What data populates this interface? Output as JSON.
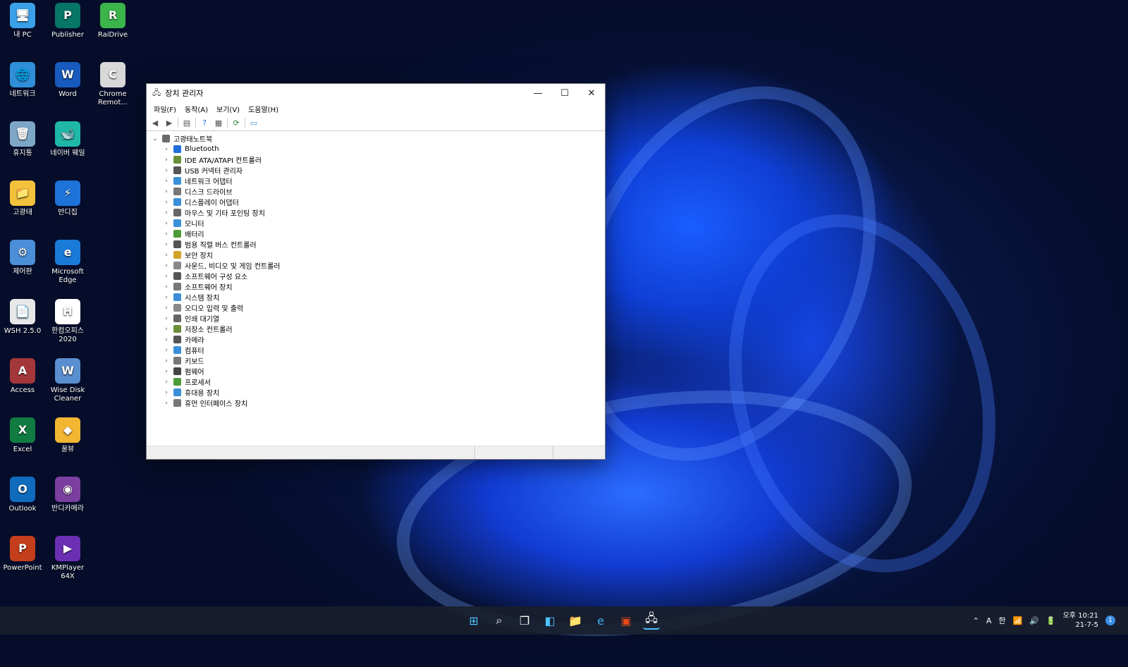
{
  "desktop_icons": [
    {
      "label": "내 PC",
      "color": "#3aa0e8",
      "glyph": "🖥"
    },
    {
      "label": "Publisher",
      "color": "#077568",
      "glyph": "P"
    },
    {
      "label": "RaiDrive",
      "color": "#3bb54a",
      "glyph": "R"
    },
    {
      "label": "네트워크",
      "color": "#2f8fd8",
      "glyph": "🌐"
    },
    {
      "label": "Word",
      "color": "#185abd",
      "glyph": "W"
    },
    {
      "label": "Chrome Remot...",
      "color": "#d8d8d8",
      "glyph": "C"
    },
    {
      "label": "휴지통",
      "color": "#7ea7c7",
      "glyph": "🗑"
    },
    {
      "label": "네이버 웨일",
      "color": "#1fb8a8",
      "glyph": "🐋"
    },
    {
      "label": "고광태",
      "color": "#f3c23c",
      "glyph": "📁"
    },
    {
      "label": "반디집",
      "color": "#1e73d8",
      "glyph": "⚡"
    },
    {
      "label": "제어판",
      "color": "#4a8fd8",
      "glyph": "⚙"
    },
    {
      "label": "Microsoft Edge",
      "color": "#1a7ad8",
      "glyph": "e"
    },
    {
      "label": "WSH 2.5.0",
      "color": "#e8e8e8",
      "glyph": "📄"
    },
    {
      "label": "한컴오피스 2020",
      "color": "#ffffff",
      "glyph": "H"
    },
    {
      "label": "Access",
      "color": "#a4373a",
      "glyph": "A"
    },
    {
      "label": "Wise Disk Cleaner",
      "color": "#5a8fcf",
      "glyph": "W"
    },
    {
      "label": "Excel",
      "color": "#107c41",
      "glyph": "X"
    },
    {
      "label": "꿀뷰",
      "color": "#f2b632",
      "glyph": "◆"
    },
    {
      "label": "Outlook",
      "color": "#0f6cbd",
      "glyph": "O"
    },
    {
      "label": "반디카메라",
      "color": "#7b3fa0",
      "glyph": "◉"
    },
    {
      "label": "PowerPoint",
      "color": "#c43e1c",
      "glyph": "P"
    },
    {
      "label": "KMPlayer 64X",
      "color": "#6a2fb3",
      "glyph": "▶"
    }
  ],
  "window": {
    "title": "장치 관리자",
    "menu": [
      "파일(F)",
      "동작(A)",
      "보기(V)",
      "도움말(H)"
    ],
    "root": "고광태노트북",
    "devices": [
      {
        "label": "Bluetooth",
        "color": "#1e6fd9"
      },
      {
        "label": "IDE ATA/ATAPI 컨트롤러",
        "color": "#6b8e3a"
      },
      {
        "label": "USB 커넥터 관리자",
        "color": "#555555"
      },
      {
        "label": "네트워크 어댑터",
        "color": "#3b8fd8"
      },
      {
        "label": "디스크 드라이브",
        "color": "#777777"
      },
      {
        "label": "디스플레이 어댑터",
        "color": "#3b8fd8"
      },
      {
        "label": "마우스 및 기타 포인팅 장치",
        "color": "#666666"
      },
      {
        "label": "모니터",
        "color": "#3b8fd8"
      },
      {
        "label": "배터리",
        "color": "#4f9a3a"
      },
      {
        "label": "범용 직렬 버스 컨트롤러",
        "color": "#555555"
      },
      {
        "label": "보안 장치",
        "color": "#d1a32a"
      },
      {
        "label": "사운드, 비디오 및 게임 컨트롤러",
        "color": "#888888"
      },
      {
        "label": "소프트웨어 구성 요소",
        "color": "#555555"
      },
      {
        "label": "소프트웨어 장치",
        "color": "#777777"
      },
      {
        "label": "시스템 장치",
        "color": "#3b8fd8"
      },
      {
        "label": "오디오 입력 및 출력",
        "color": "#888888"
      },
      {
        "label": "인쇄 대기열",
        "color": "#666666"
      },
      {
        "label": "저장소 컨트롤러",
        "color": "#6b8e3a"
      },
      {
        "label": "카메라",
        "color": "#555555"
      },
      {
        "label": "컴퓨터",
        "color": "#3b8fd8"
      },
      {
        "label": "키보드",
        "color": "#777777"
      },
      {
        "label": "펌웨어",
        "color": "#444444"
      },
      {
        "label": "프로세서",
        "color": "#4f9a3a"
      },
      {
        "label": "휴대용 장치",
        "color": "#3b8fd8"
      },
      {
        "label": "휴먼 인터페이스 장치",
        "color": "#777777"
      }
    ]
  },
  "taskbar": {
    "tray_ime_a": "A",
    "tray_ime_han": "한",
    "clock_time": "오후 10:21",
    "clock_date": "21-7-5",
    "notification_count": "1"
  }
}
